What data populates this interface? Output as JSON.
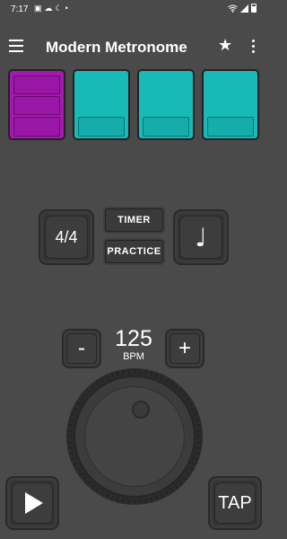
{
  "status_bar": {
    "time": "7:17",
    "indicators": [
      "image-icon",
      "cloud-icon",
      "moon-icon",
      "dot-icon"
    ],
    "right_icons": [
      "wifi-icon",
      "signal-icon",
      "battery-icon"
    ]
  },
  "app_bar": {
    "title": "Modern Metronome",
    "menu_icon": "menu-icon",
    "favorite_icon": "star-icon",
    "more_icon": "more-vert-icon"
  },
  "beats": [
    {
      "type": "accent",
      "color": "#a21aae",
      "levels": 3
    },
    {
      "type": "normal",
      "color": "#18bab8",
      "levels": 1
    },
    {
      "type": "normal",
      "color": "#18bab8",
      "levels": 1
    },
    {
      "type": "normal",
      "color": "#18bab8",
      "levels": 1
    }
  ],
  "controls": {
    "time_signature": "4/4",
    "timer_label": "TIMER",
    "practice_label": "PRACTICE",
    "note_glyph": "♩"
  },
  "tempo": {
    "value": "125",
    "unit": "BPM",
    "minus_label": "-",
    "plus_label": "+"
  },
  "bottom": {
    "play_icon": "play-icon",
    "tap_label": "TAP"
  }
}
